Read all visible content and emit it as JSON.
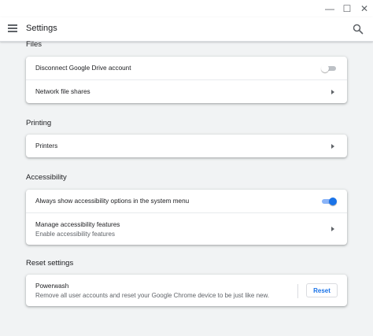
{
  "window": {
    "minimize_glyph": "—",
    "maximize_glyph": "☐",
    "close_glyph": "✕"
  },
  "header": {
    "title": "Settings"
  },
  "sections": {
    "files": {
      "title": "Files",
      "disconnect_label": "Disconnect Google Drive account",
      "disconnect_toggle": "off",
      "network_label": "Network file shares"
    },
    "printing": {
      "title": "Printing",
      "printers_label": "Printers"
    },
    "accessibility": {
      "title": "Accessibility",
      "always_show_label": "Always show accessibility options in the system menu",
      "always_show_toggle": "on",
      "manage_label": "Manage accessibility features",
      "manage_secondary": "Enable accessibility features"
    },
    "reset": {
      "title": "Reset settings",
      "powerwash_label": "Powerwash",
      "powerwash_secondary": "Remove all user accounts and reset your Google Chrome device to be just like new.",
      "reset_button": "Reset"
    }
  },
  "colors": {
    "accent": "#1a73e8",
    "background": "#f1f3f4"
  }
}
